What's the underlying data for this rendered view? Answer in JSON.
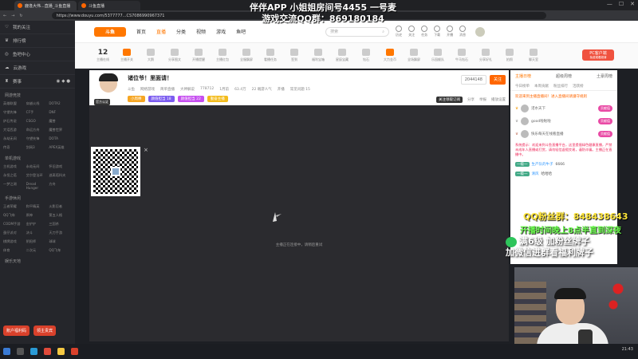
{
  "browser": {
    "tabs": [
      "鹿逢大伟...直播_斗鱼直播",
      "斗鱼直播"
    ],
    "url": "https://www.douyu.com/5377777...CS7086990967371"
  },
  "sidebar": {
    "main": [
      "我的关注",
      "排行榜",
      "鱼吧中心",
      "云游戏",
      "赛事"
    ],
    "sections": [
      {
        "title": "网游竞技",
        "items": [
          "英雄联盟",
          "穿越火线",
          "DOTA2",
          "守望先锋",
          "CF手",
          "DNF",
          "炉石传说",
          "CSGO",
          "魔兽",
          "大话西游",
          "命运方舟",
          "魔兽世界",
          "永劫无间",
          "守望先锋",
          "DOTA",
          "传奇",
          "剑网3",
          "APEX英雄"
        ]
      },
      {
        "title": "单机游戏",
        "items": [
          "主机游戏",
          "永劫无间",
          "怀旧游戏",
          "永恒之塔",
          "艾尔登法环",
          "逃离塔科夫",
          "一梦江湖",
          "Dread Hunger",
          "方舟"
        ]
      },
      {
        "title": "手游休闲",
        "items": [
          "王者荣耀",
          "和平精英",
          "火影忍者",
          "QQ飞车",
          "原神",
          "第五人格",
          "CODM手游",
          "金铲铲",
          "三国杀",
          "蛋仔派对",
          "决斗",
          "天刀手游",
          "棋牌游戏",
          "阴阳师",
          "球球",
          "体育",
          "二次元",
          "QQ飞车"
        ]
      },
      {
        "title": "娱乐天地",
        "items": []
      }
    ],
    "bottom_buttons": [
      "账户福利码",
      "领主贵宾"
    ]
  },
  "topnav": {
    "logo": "斗鱼",
    "links": [
      "首页",
      "直播",
      "分类",
      "视频",
      "游戏",
      "鱼吧"
    ],
    "active": "直播",
    "search_placeholder": "搜索",
    "icons": [
      "历史",
      "关注",
      "任务",
      "下载",
      "开播",
      "消息"
    ]
  },
  "giftbar": {
    "count": "12",
    "count_label": "主播在线",
    "items": [
      "主播开关",
      "大鹅",
      "分享图文",
      "开播提醒",
      "主播红包",
      "全服飘屏",
      "看播任务",
      "签到",
      "福利宝箱",
      "星辰宝藏",
      "钻石",
      "大力金币",
      "全场飘屏",
      "乐园舰队",
      "牛马钻石",
      "分享好礼",
      "拍照",
      "聊天室"
    ],
    "pc_client": "PC客户端",
    "pc_client_sub": "免费观看超清"
  },
  "stream": {
    "title": "诸位爷！里面请！",
    "avatar_tag": "官方认证",
    "meta": [
      "斗鱼",
      "网络游戏",
      "简单直播",
      "大神解说",
      "778712",
      "1月前",
      "63.4万",
      "22 端游人气",
      "开播",
      "常见问题 15"
    ],
    "badges": [
      {
        "text": "小周棒",
        "color": "#f6a623"
      },
      {
        "text": "颜值担当 18",
        "color": "#7b5cf0"
      },
      {
        "text": "颜值担当 22",
        "color": "#c64ff0"
      },
      {
        "text": "勤奋主播",
        "color": "#f3bc1c"
      }
    ],
    "fans": "2044148",
    "follow": "关注",
    "tools": [
      "分享",
      "举报",
      "播放设置"
    ],
    "subscribe": "关注领取订阅"
  },
  "player": {
    "loading_text": "主播正在连接中，请稍后重试"
  },
  "chat": {
    "tabs": [
      "主播日榜",
      "超级周榜",
      "土豪周榜"
    ],
    "active_tab": "主播日榜",
    "subtabs": [
      "今日榜单",
      "本周贡献",
      "粉丝排行",
      "活跃榜"
    ],
    "notice": "欢迎来到主播直播间！进入直播间请遵守规则",
    "ranks": [
      {
        "name": "渃水天下",
        "pill": "贡献值"
      },
      {
        "name": "good啦啦啦",
        "pill": "贡献值"
      },
      {
        "name": "快乐每天在线看直播",
        "pill": "贡献值"
      }
    ],
    "system": "系统提示：欢迎来到斗鱼直播平台，这里提倡绿色健康直播，严禁未成年人直播或打赏，请勿轻信虚假交易，谨防诈骗。主播正在直播中。",
    "messages": [
      {
        "level": "一级一",
        "user": "生产队的牛子",
        "text": "6666"
      },
      {
        "level": "一级一",
        "user": "清风",
        "text": "哈哈哈"
      }
    ]
  },
  "overlays": {
    "top_line1": "伴伴APP 小姐姐房间号4455 一号麦",
    "top_line2": "游戏交流QQ群：869180184",
    "qq": "QQ粉丝群：848438643",
    "green": "开播时间晚上8点半直到深夜",
    "wechat1": "满6级 加粉丝牌子",
    "wechat2": "加微信进群看福利牌子"
  },
  "taskbar": {
    "time": "21:43"
  }
}
